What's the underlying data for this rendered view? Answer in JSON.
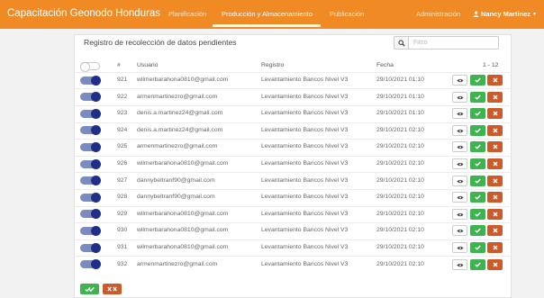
{
  "navbar": {
    "brand": "Capacitación Geonodo Honduras",
    "links": [
      "Planificación",
      "Producción y Almacenamiento",
      "Publicación",
      "Administración"
    ],
    "user": "Nancy Martinez",
    "colors": {
      "bar": "#f08a24"
    }
  },
  "panel": {
    "title": "Registro de recolección de datos pendientes",
    "search_placeholder": "Filtro",
    "range": "1 - 12"
  },
  "columns": [
    "#",
    "Usuario",
    "Registro",
    "Fecha"
  ],
  "rows": [
    {
      "id": "921",
      "user": "wilmerbarahona0810@gmail.com",
      "registro": "Levantamiento Bancos Nivel V3",
      "fecha": "29/10/2021 01:10",
      "enabled": true
    },
    {
      "id": "922",
      "user": "armenmartinezro@gmail.com",
      "registro": "Levantamiento Bancos Nivel V3",
      "fecha": "29/10/2021 01:10",
      "enabled": true
    },
    {
      "id": "923",
      "user": "denis.a.martinez24@gmail.com",
      "registro": "Levantamiento Bancos Nivel V3",
      "fecha": "29/10/2021 01:10",
      "enabled": true
    },
    {
      "id": "924",
      "user": "denis.a.martinez24@gmail.com",
      "registro": "Levantamiento Bancos Nivel V3",
      "fecha": "29/10/2021 02:10",
      "enabled": true
    },
    {
      "id": "925",
      "user": "armenmartinezro@gmail.com",
      "registro": "Levantamiento Bancos Nivel V3",
      "fecha": "29/10/2021 02:10",
      "enabled": true
    },
    {
      "id": "926",
      "user": "wilmerbarahona0810@gmail.com",
      "registro": "Levantamiento Bancos Nivel V3",
      "fecha": "29/10/2021 02:10",
      "enabled": true
    },
    {
      "id": "927",
      "user": "dannybeltranf90@gmail.com",
      "registro": "Levantamiento Bancos Nivel V3",
      "fecha": "29/10/2021 02:10",
      "enabled": true
    },
    {
      "id": "928",
      "user": "dannybeltranf90@gmail.com",
      "registro": "Levantamiento Bancos Nivel V3",
      "fecha": "29/10/2021 02:10",
      "enabled": true
    },
    {
      "id": "929",
      "user": "wilmerbarahona0810@gmail.com",
      "registro": "Levantamiento Bancos Nivel V3",
      "fecha": "29/10/2021 02:10",
      "enabled": true
    },
    {
      "id": "930",
      "user": "wilmerbarahona0810@gmail.com",
      "registro": "Levantamiento Bancos Nivel V3",
      "fecha": "29/10/2021 02:10",
      "enabled": true
    },
    {
      "id": "931",
      "user": "wilmerbarahona0810@gmail.com",
      "registro": "Levantamiento Bancos Nivel V3",
      "fecha": "29/10/2021 02:10",
      "enabled": true
    },
    {
      "id": "932",
      "user": "armenmartinezro@gmail.com",
      "registro": "Levantamiento Bancos Nivel V3",
      "fecha": "29/10/2021 02:10",
      "enabled": true
    }
  ],
  "master_toggle_enabled": false,
  "icons": {
    "search": "search-icon",
    "view": "eye-icon",
    "approve": "check-icon",
    "reject": "x-icon",
    "user": "user-icon"
  },
  "colors": {
    "approve": "#3fb34f",
    "reject": "#cc5a2a",
    "toggle_on": "#1f2f88"
  }
}
